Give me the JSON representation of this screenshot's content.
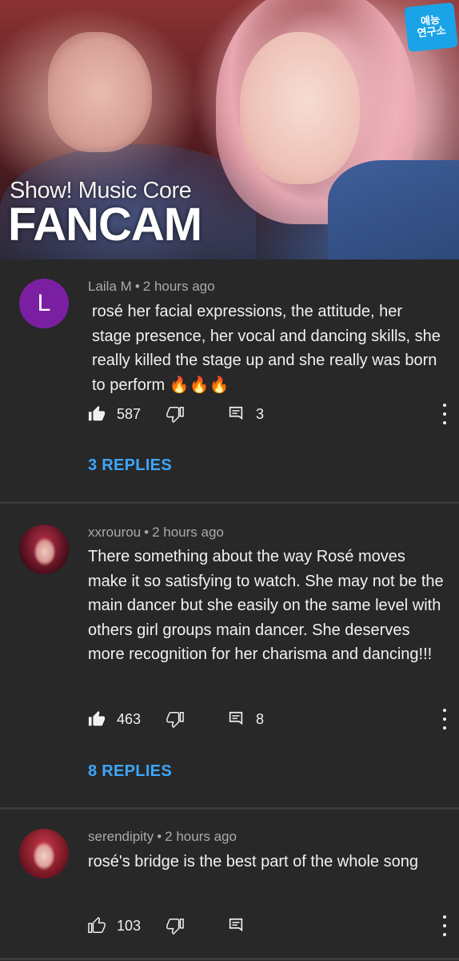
{
  "video": {
    "overlay_line1": "Show! Music Core",
    "overlay_line2": "FANCAM",
    "channel_logo_text": "예능\n연구소"
  },
  "comments": [
    {
      "avatar_type": "letter",
      "avatar_letter": "L",
      "avatar_color": "#7b1fa2",
      "author": "Laila M",
      "time": "2 hours ago",
      "text": "rosé her facial expressions, the attitude, her stage presence, her vocal and dancing skills, she really killed the stage up and she really was born to perform 🔥🔥🔥",
      "likes": "587",
      "liked": true,
      "reply_count": "3",
      "replies_label": "3 REPLIES"
    },
    {
      "avatar_type": "photo",
      "author": "xxrourou",
      "time": "2 hours ago",
      "text": "There something about the way Rosé moves make it so satisfying to watch. She may not be the main dancer but she easily on the same level with others girl groups main dancer. She deserves more recognition for her charisma and dancing!!!",
      "likes": "463",
      "liked": true,
      "reply_count": "8",
      "replies_label": "8 REPLIES"
    },
    {
      "avatar_type": "photo",
      "author": "serendipity",
      "time": "2 hours ago",
      "text": "rosé's bridge is the best part of the whole song",
      "likes": "103",
      "liked": false,
      "reply_count": ""
    }
  ],
  "separator": "•",
  "accent_color": "#3ea6ff",
  "icons": {
    "like": "thumbs-up-icon",
    "dislike": "thumbs-down-icon",
    "reply": "comment-reply-icon",
    "more": "more-vert-icon"
  }
}
